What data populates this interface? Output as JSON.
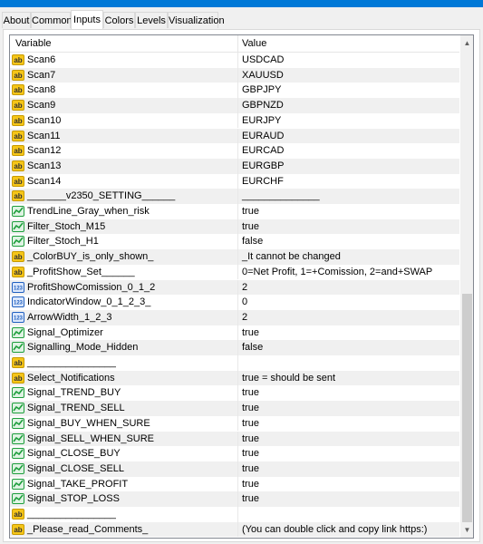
{
  "tabs": [
    {
      "label": "About"
    },
    {
      "label": "Common"
    },
    {
      "label": "Inputs",
      "active": true
    },
    {
      "label": "Colors"
    },
    {
      "label": "Levels"
    },
    {
      "label": "Visualization"
    }
  ],
  "grid": {
    "columns": {
      "variable": "Variable",
      "value": "Value"
    },
    "rows": [
      {
        "name": "Scan6",
        "value": "USDCAD",
        "type": "string"
      },
      {
        "name": "Scan7",
        "value": "XAUUSD",
        "type": "string"
      },
      {
        "name": "Scan8",
        "value": "GBPJPY",
        "type": "string"
      },
      {
        "name": "Scan9",
        "value": "GBPNZD",
        "type": "string"
      },
      {
        "name": "Scan10",
        "value": "EURJPY",
        "type": "string"
      },
      {
        "name": "Scan11",
        "value": "EURAUD",
        "type": "string"
      },
      {
        "name": "Scan12",
        "value": "EURCAD",
        "type": "string"
      },
      {
        "name": "Scan13",
        "value": "EURGBP",
        "type": "string"
      },
      {
        "name": "Scan14",
        "value": "EURCHF",
        "type": "string"
      },
      {
        "name": "_______v2350_SETTING______",
        "value": "______________",
        "type": "string"
      },
      {
        "name": "TrendLine_Gray_when_risk",
        "value": "true",
        "type": "bool"
      },
      {
        "name": "Filter_Stoch_M15",
        "value": "true",
        "type": "bool"
      },
      {
        "name": "Filter_Stoch_H1",
        "value": "false",
        "type": "bool"
      },
      {
        "name": "_ColorBUY_is_only_shown_",
        "value": "_It cannot be changed",
        "type": "string"
      },
      {
        "name": "_ProfitShow_Set______",
        "value": "0=Net Profit, 1=+Comission, 2=and+SWAP",
        "type": "string"
      },
      {
        "name": "ProfitShowComission_0_1_2",
        "value": "2",
        "type": "int"
      },
      {
        "name": "IndicatorWindow_0_1_2_3_",
        "value": "0",
        "type": "int"
      },
      {
        "name": "ArrowWidth_1_2_3",
        "value": "2",
        "type": "int"
      },
      {
        "name": "Signal_Optimizer",
        "value": "true",
        "type": "bool"
      },
      {
        "name": "Signalling_Mode_Hidden",
        "value": "false",
        "type": "bool"
      },
      {
        "name": "________________",
        "value": "",
        "type": "string"
      },
      {
        "name": "Select_Notifications",
        "value": "true = should be sent",
        "type": "string"
      },
      {
        "name": "Signal_TREND_BUY",
        "value": "true",
        "type": "bool"
      },
      {
        "name": "Signal_TREND_SELL",
        "value": "true",
        "type": "bool"
      },
      {
        "name": "Signal_BUY_WHEN_SURE",
        "value": "true",
        "type": "bool"
      },
      {
        "name": "Signal_SELL_WHEN_SURE",
        "value": "true",
        "type": "bool"
      },
      {
        "name": "Signal_CLOSE_BUY",
        "value": "true",
        "type": "bool"
      },
      {
        "name": "Signal_CLOSE_SELL",
        "value": "true",
        "type": "bool"
      },
      {
        "name": "Signal_TAKE_PROFIT",
        "value": "true",
        "type": "bool"
      },
      {
        "name": "Signal_STOP_LOSS",
        "value": "true",
        "type": "bool"
      },
      {
        "name": "________________",
        "value": "",
        "type": "string"
      },
      {
        "name": "_Please_read_Comments_",
        "value": "(You can double click and copy link https:)",
        "type": "string"
      }
    ]
  },
  "icons": {
    "string": "ab-string-icon",
    "bool": "bool-chart-icon",
    "int": "int-123-icon"
  },
  "colors": {
    "accent": "#0078d7",
    "row_alt": "#f0f0f0",
    "ab_icon": "#f5c518",
    "bool_icon": "#1e9e3c",
    "int_icon": "#2060c0"
  }
}
